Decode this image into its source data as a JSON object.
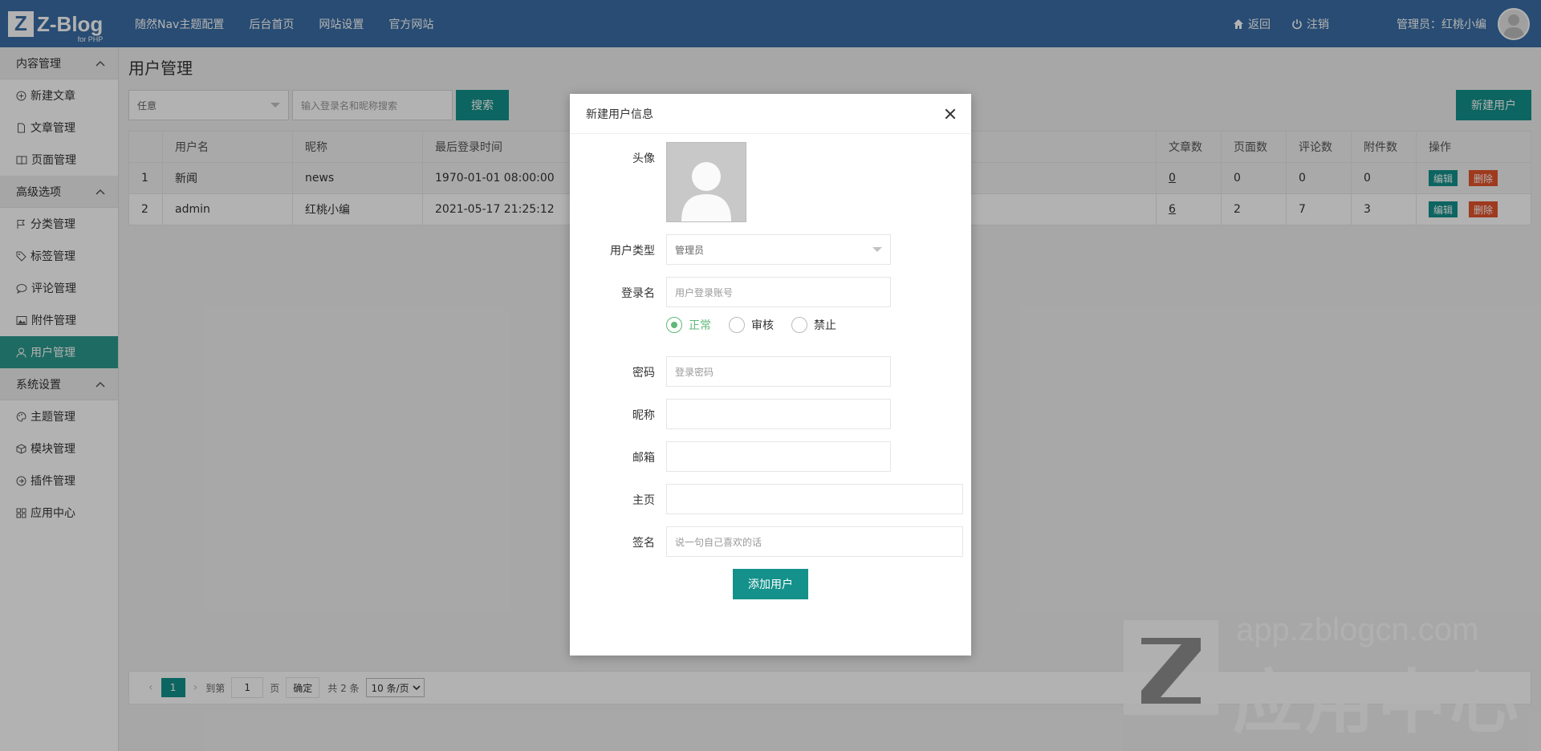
{
  "topbar": {
    "logo_mark": "Z",
    "logo_text": "Z-Blog",
    "logo_sub": "for PHP",
    "nav": [
      "随然Nav主题配置",
      "后台首页",
      "网站设置",
      "官方网站"
    ],
    "back_label": "返回",
    "logout_label": "注销",
    "admin_label": "管理员：红桃小编"
  },
  "sidebar": {
    "group_content": "内容管理",
    "new_article": "新建文章",
    "article_manage": "文章管理",
    "page_manage": "页面管理",
    "group_advanced": "高级选项",
    "category_manage": "分类管理",
    "tag_manage": "标签管理",
    "comment_manage": "评论管理",
    "attachment_manage": "附件管理",
    "user_manage": "用户管理",
    "group_system": "系统设置",
    "theme_manage": "主题管理",
    "module_manage": "模块管理",
    "plugin_manage": "插件管理",
    "app_center": "应用中心"
  },
  "main": {
    "title": "用户管理",
    "filter_select": "任意",
    "search_placeholder": "输入登录名和昵称搜索",
    "search_button": "搜索",
    "new_user_button": "新建用户",
    "table": {
      "headers": {
        "username": "用户名",
        "nickname": "昵称",
        "last_login": "最后登录时间",
        "articles": "文章数",
        "pages": "页面数",
        "comments": "评论数",
        "attachments": "附件数",
        "ops": "操作"
      },
      "rows": [
        {
          "idx": "1",
          "username": "新闻",
          "nickname": "news",
          "last_login": "1970-01-01 08:00:00",
          "articles": "0",
          "pages": "0",
          "comments": "0",
          "attachments": "0"
        },
        {
          "idx": "2",
          "username": "admin",
          "nickname": "红桃小编",
          "last_login": "2021-05-17 21:25:12",
          "articles": "6",
          "pages": "2",
          "comments": "7",
          "attachments": "3"
        }
      ],
      "edit_label": "编辑",
      "delete_label": "删除"
    },
    "pager": {
      "current": "1",
      "goto_label": "到第",
      "page_input": "1",
      "page_unit": "页",
      "confirm": "确定",
      "total": "共 2 条",
      "page_size": "10 条/页"
    }
  },
  "watermark": {
    "url": "app.zblogcn.com",
    "cn": "应用中心"
  },
  "modal": {
    "title": "新建用户信息",
    "avatar_label": "头像",
    "type_label": "用户类型",
    "type_value": "管理员",
    "login_label": "登录名",
    "login_placeholder": "用户登录账号",
    "status_options": [
      "正常",
      "审核",
      "禁止"
    ],
    "password_label": "密码",
    "password_placeholder": "登录密码",
    "nickname_label": "昵称",
    "email_label": "邮箱",
    "homepage_label": "主页",
    "signature_label": "签名",
    "signature_placeholder": "说一句自己喜欢的话",
    "submit": "添加用户"
  },
  "colors": {
    "topbar": "#3a6ea5",
    "accent": "#14918b",
    "danger": "#e2542b",
    "radio_on": "#5fb878"
  }
}
